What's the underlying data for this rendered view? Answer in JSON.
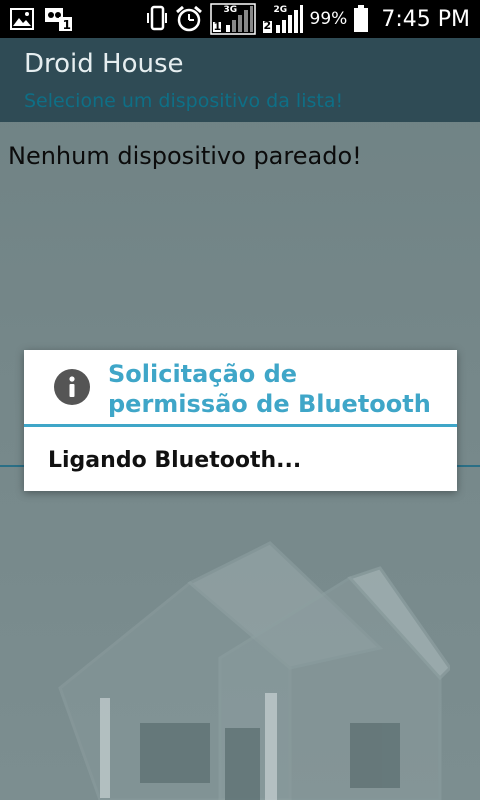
{
  "status_bar": {
    "battery_percent": "99%",
    "time": "7:45 PM",
    "sim1_network": "3G",
    "sim2_network": "2G",
    "sim1_slot": "1",
    "sim2_slot": "2",
    "icons": [
      "gallery-icon",
      "voicemail-icon",
      "vibrate-icon",
      "alarm-icon",
      "signal-sim1-icon",
      "signal-sim2-icon",
      "battery-icon"
    ]
  },
  "app": {
    "title": "Droid House",
    "subtitle": "Selecione um dispositivo da lista!",
    "empty_message": "Nenhum dispositivo pareado!"
  },
  "dialog": {
    "title": "Solicitação de permissão de Bluetooth",
    "message": "Ligando Bluetooth...",
    "icon": "info-icon"
  },
  "colors": {
    "actionbar": "#2f4b55",
    "accent": "#3fa6c8",
    "subtitle": "#0e6f86"
  }
}
